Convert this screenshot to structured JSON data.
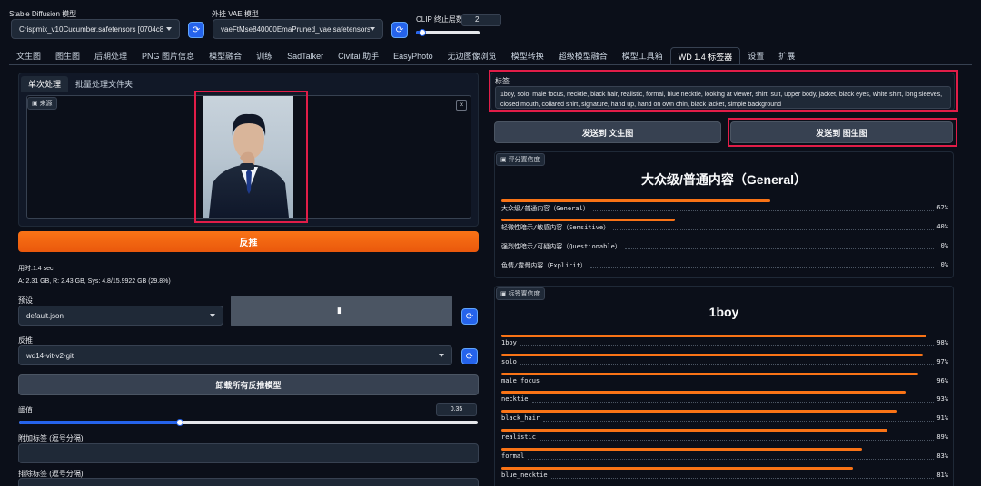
{
  "top": {
    "model_label": "Stable Diffusion 模型",
    "model_value": "Crispmix_v10Cucumber.safetensors [0704c8559",
    "vae_label": "外挂 VAE 模型",
    "vae_value": "vaeFtMse840000EmaPruned_vae.safetensors",
    "clip_label": "CLIP 终止层数",
    "clip_value": "2",
    "clip_fraction": 0.1
  },
  "tabs": [
    "文生图",
    "图生图",
    "后期处理",
    "PNG 图片信息",
    "模型融合",
    "训练",
    "SadTalker",
    "Civitai 助手",
    "EasyPhoto",
    "无边图像浏览",
    "模型转换",
    "超级模型融合",
    "模型工具箱",
    "WD 1.4 标签器",
    "设置",
    "扩展"
  ],
  "active_tab": "WD 1.4 标签器",
  "left": {
    "subtabs": [
      "单次处理",
      "批量处理文件夹"
    ],
    "source_chip": "来源",
    "interrogate_button": "反推",
    "time_text": "用时:1.4 sec.",
    "mem_text": "A: 2.31 GB, R: 2.43 GB, Sys: 4.8/15.9922 GB (29.8%)",
    "preset_label": "预设",
    "preset_value": "default.json",
    "interrogator_label": "反推",
    "interrogator_value": "wd14-vit-v2-git",
    "unload_button": "卸载所有反推模型",
    "threshold_label": "阈值",
    "threshold_value": "0.35",
    "threshold_fraction": 0.35,
    "additional_tags_label": "附加标签 (逗号分隔)",
    "exclude_tags_label": "排除标签 (逗号分隔)"
  },
  "right": {
    "tags_label": "标签",
    "tags_text": "1boy, solo, male focus, necktie, black hair, realistic, formal, blue necktie, looking at viewer, shirt, suit, upper body, jacket, black eyes, white shirt, long sleeves, closed mouth, collared shirt, signature, hand up, hand on own chin, black jacket, simple background",
    "send_txt2img": "发送到 文生图",
    "send_img2img": "发送到 图生图",
    "rating_chip": "评分置信度",
    "rating_title": "大众级/普通内容（General）",
    "ratings": [
      {
        "name": "大众级/普通内容（General）",
        "value": 62,
        "pct": "62%"
      },
      {
        "name": "轻微性暗示/敏感内容（Sensitive）",
        "value": 40,
        "pct": "40%"
      },
      {
        "name": "强烈性暗示/可疑内容（Questionable）",
        "value": 0,
        "pct": "0%"
      },
      {
        "name": "色情/露骨内容（Explicit）",
        "value": 0,
        "pct": "0%"
      }
    ],
    "tag_chip": "标签置信度",
    "tag_title": "1boy",
    "tag_conf": [
      {
        "name": "1boy",
        "value": 98,
        "pct": "98%"
      },
      {
        "name": "solo",
        "value": 97,
        "pct": "97%"
      },
      {
        "name": "male_focus",
        "value": 96,
        "pct": "96%"
      },
      {
        "name": "necktie",
        "value": 93,
        "pct": "93%"
      },
      {
        "name": "black_hair",
        "value": 91,
        "pct": "91%"
      },
      {
        "name": "realistic",
        "value": 89,
        "pct": "89%"
      },
      {
        "name": "formal",
        "value": 83,
        "pct": "83%"
      },
      {
        "name": "blue_necktie",
        "value": 81,
        "pct": "81%"
      }
    ]
  }
}
